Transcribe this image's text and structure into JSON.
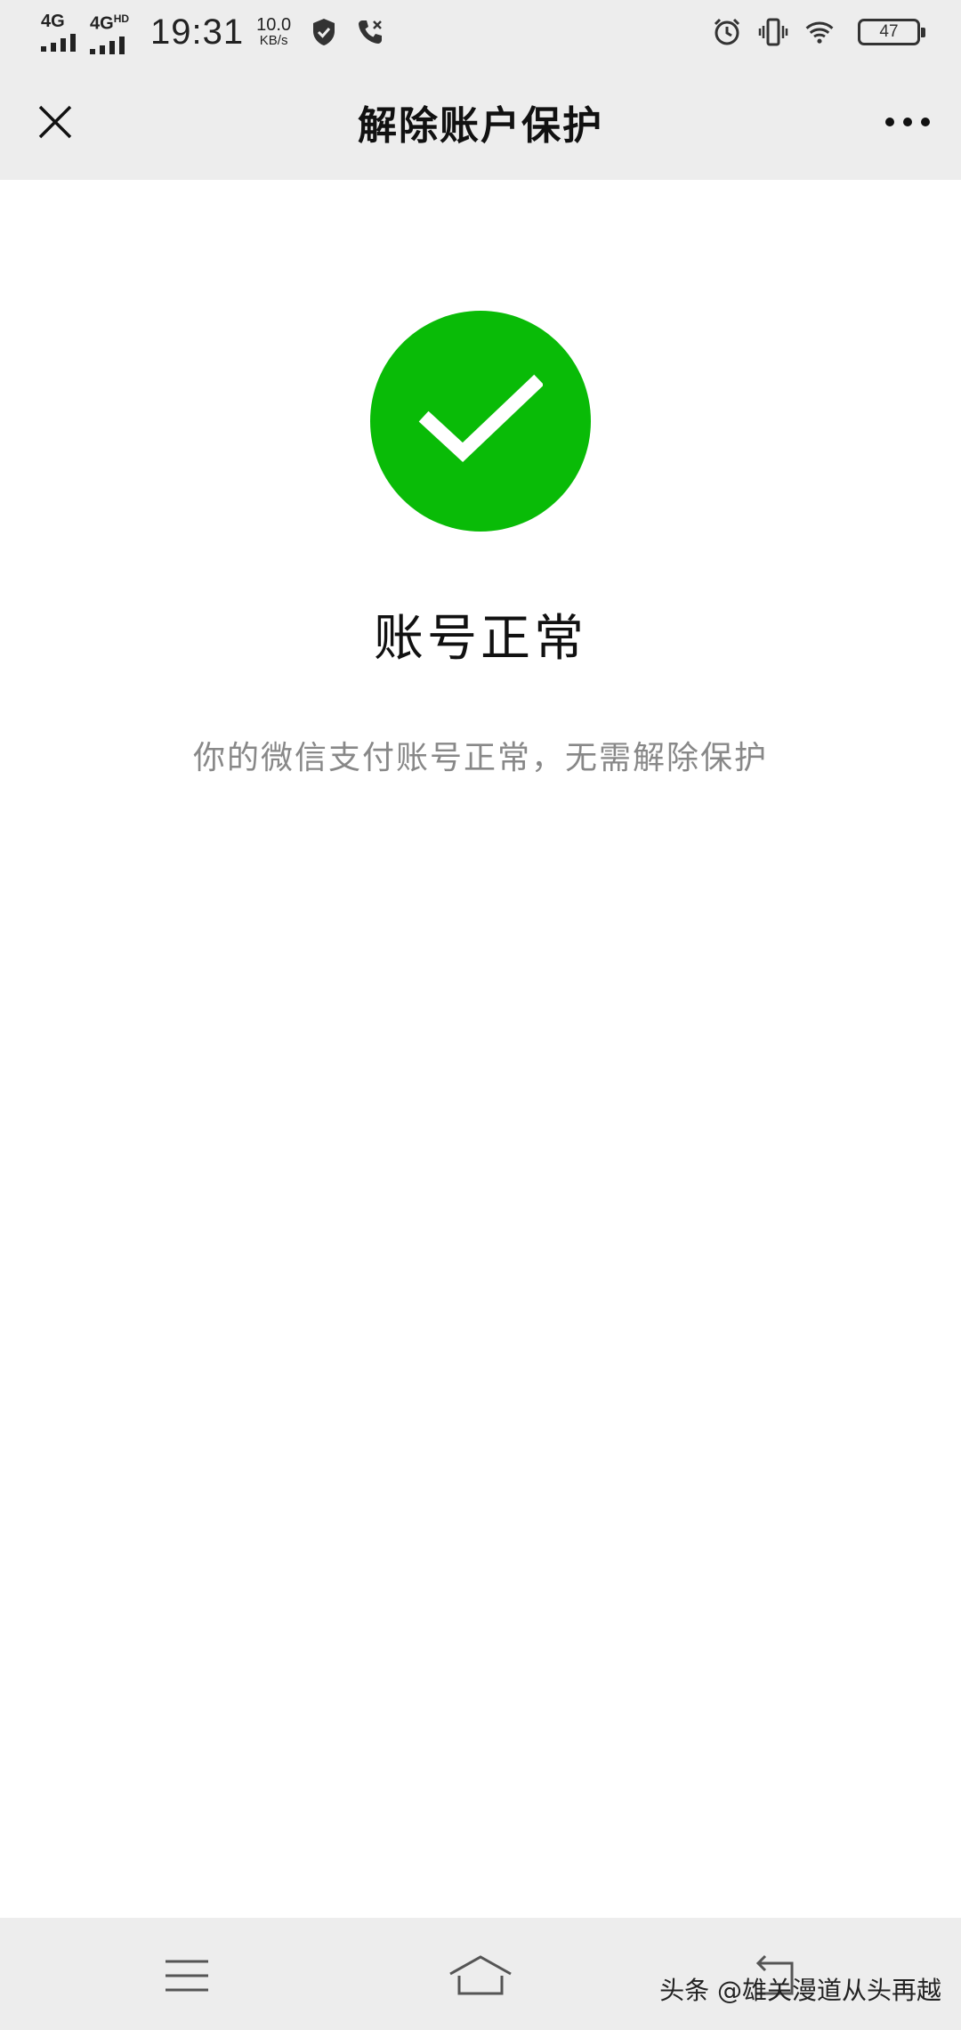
{
  "status_bar": {
    "network_1": "4G",
    "network_2": "4G",
    "network_2_sup": "HD",
    "time": "19:31",
    "speed_value": "10.0",
    "speed_unit": "KB/s",
    "battery": "47"
  },
  "nav": {
    "title": "解除账户保护"
  },
  "result": {
    "status_color": "#09bb07",
    "title": "账号正常",
    "description": "你的微信支付账号正常，无需解除保护"
  },
  "watermark": "头条 @雄关漫道从头再越"
}
